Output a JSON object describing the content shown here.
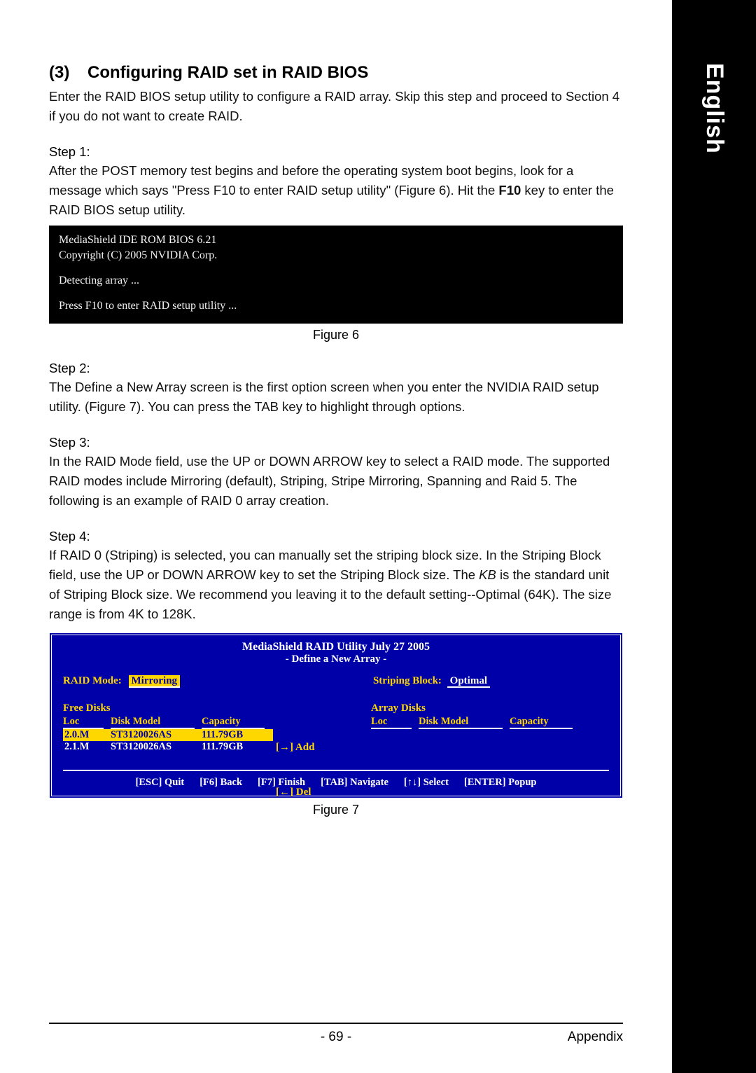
{
  "side_tab": "English",
  "section": {
    "num": "(3)",
    "title": "Configuring RAID set in RAID BIOS"
  },
  "intro": "Enter the RAID BIOS setup utility to configure a RAID array. Skip this step and proceed to Section 4 if you do not want to create RAID.",
  "steps": {
    "s1_label": "Step 1:",
    "s1_text_a": "After the POST memory test begins and before the operating system boot begins, look for a message which says \"Press F10 to enter RAID setup utility\" (Figure 6). Hit the ",
    "s1_bold": "F10",
    "s1_text_b": " key to enter the RAID BIOS setup utility.",
    "s2_label": "Step 2:",
    "s2_text": "The Define a New Array screen is the first option screen when you enter the NVIDIA RAID setup utility. (Figure 7). You can press the TAB key to highlight through options.",
    "s3_label": "Step 3:",
    "s3_text": "In the RAID Mode field, use the UP or DOWN ARROW key to select a RAID mode. The supported RAID modes include Mirroring (default), Striping, Stripe Mirroring, Spanning and Raid 5. The following is an example of RAID 0 array creation.",
    "s4_label": "Step 4:",
    "s4_text_a": "If RAID 0 (Striping) is selected, you can manually set the striping block size. In the Striping Block field, use the UP or DOWN ARROW key to set the Striping Block size. The ",
    "s4_italic": "KB",
    "s4_text_b": " is the standard unit of Striping Block size.  We recommend you leaving it to the default setting--Optimal (64K). The size range is from 4K to 128K."
  },
  "console": {
    "l1": "MediaShield IDE ROM BIOS 6.21",
    "l2": "Copyright (C) 2005 NVIDIA Corp.",
    "l3": "Detecting array ...",
    "l4": "Press F10 to enter RAID setup utility ..."
  },
  "fig6": "Figure 6",
  "fig7": "Figure 7",
  "raid": {
    "title": "MediaShield RAID Utility  July 27 2005",
    "subtitle": "- Define a New Array -",
    "mode_label": "RAID Mode:",
    "mode_value": "Mirroring",
    "block_label": "Striping Block:",
    "block_value": "Optimal",
    "free_head": "Free Disks",
    "array_head": "Array Disks",
    "col_loc": "Loc",
    "col_model": "Disk Model",
    "col_cap": "Capacity",
    "disks": [
      {
        "loc": "2.0.M",
        "model": "ST3120026AS",
        "cap": "111.79GB",
        "selected": true
      },
      {
        "loc": "2.1.M",
        "model": "ST3120026AS",
        "cap": "111.79GB",
        "selected": false
      }
    ],
    "add": "[→] Add",
    "del": "[←] Del",
    "footer": [
      "[ESC] Quit",
      "[F6] Back",
      "[F7] Finish",
      "[TAB] Navigate",
      "[↑↓] Select",
      "[ENTER] Popup"
    ]
  },
  "footer": {
    "page": "- 69 -",
    "section": "Appendix"
  }
}
